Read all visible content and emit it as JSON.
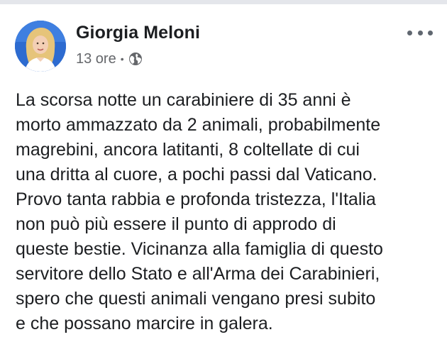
{
  "post": {
    "author": {
      "name": "Giorgia Meloni",
      "avatar_icon": "profile-photo"
    },
    "meta": {
      "time": "13 ore",
      "separator": "•",
      "privacy_icon": "globe-icon"
    },
    "more_icon": "more-options-icon",
    "body_lines": [
      "La scorsa notte un carabiniere di 35 anni è",
      "morto ammazzato da 2 animali, probabilmente",
      "magrebini, ancora latitanti, 8 coltellate di cui",
      "una dritta al cuore, a pochi passi dal Vaticano.",
      "Provo tanta rabbia e profonda tristezza, l'Italia",
      "non può più essere il punto di approdo di",
      "queste bestie. Vicinanza alla famiglia di questo",
      "servitore dello Stato e all'Arma dei Carabinieri,",
      "spero che questi animali vengano presi subito",
      "e che possano marcire in galera."
    ]
  },
  "colors": {
    "name": "#1c1e21",
    "meta": "#65676b",
    "text": "#1c1e21",
    "avatar_bg": "#2d6bd0"
  }
}
